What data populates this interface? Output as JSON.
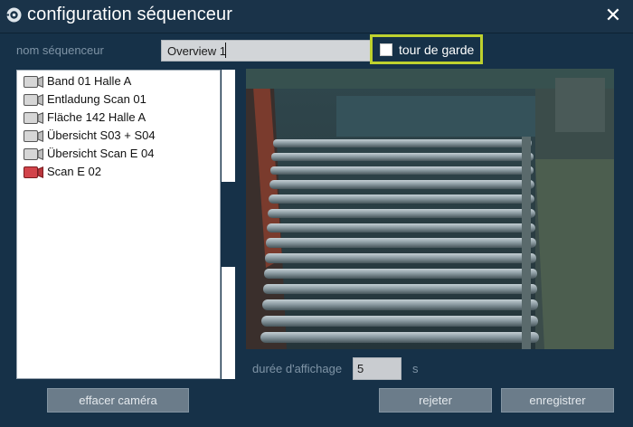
{
  "window": {
    "title": "configuration séquenceur",
    "close_glyph": "✕"
  },
  "name_field": {
    "label": "nom séquenceur",
    "value": "Overview 1"
  },
  "guard_tour": {
    "label": "tour de garde",
    "checked": false,
    "highlight_color": "#bed12e"
  },
  "camera_list": {
    "items": [
      {
        "label": "Band 01 Halle A",
        "icon": "camera-icon",
        "status": "normal"
      },
      {
        "label": "Entladung Scan 01",
        "icon": "camera-icon",
        "status": "normal"
      },
      {
        "label": "Fläche 142 Halle A",
        "icon": "camera-icon",
        "status": "normal"
      },
      {
        "label": "Übersicht S03 + S04",
        "icon": "camera-icon",
        "status": "normal"
      },
      {
        "label": "Übersicht Scan E 04",
        "icon": "camera-icon",
        "status": "normal"
      },
      {
        "label": "Scan E 02",
        "icon": "camera-icon",
        "status": "alert"
      }
    ]
  },
  "preview": {
    "content": "camera-feed-roller-conveyor"
  },
  "display_duration": {
    "label": "durée d'affichage",
    "value": "5",
    "unit": "s"
  },
  "buttons": {
    "clear_camera": "effacer caméra",
    "reject": "rejeter",
    "save": "enregistrer"
  },
  "colors": {
    "background": "#163148",
    "button": "#6b7c8a",
    "alert_icon": "#c8393e",
    "normal_icon": "#cfcfcf"
  }
}
